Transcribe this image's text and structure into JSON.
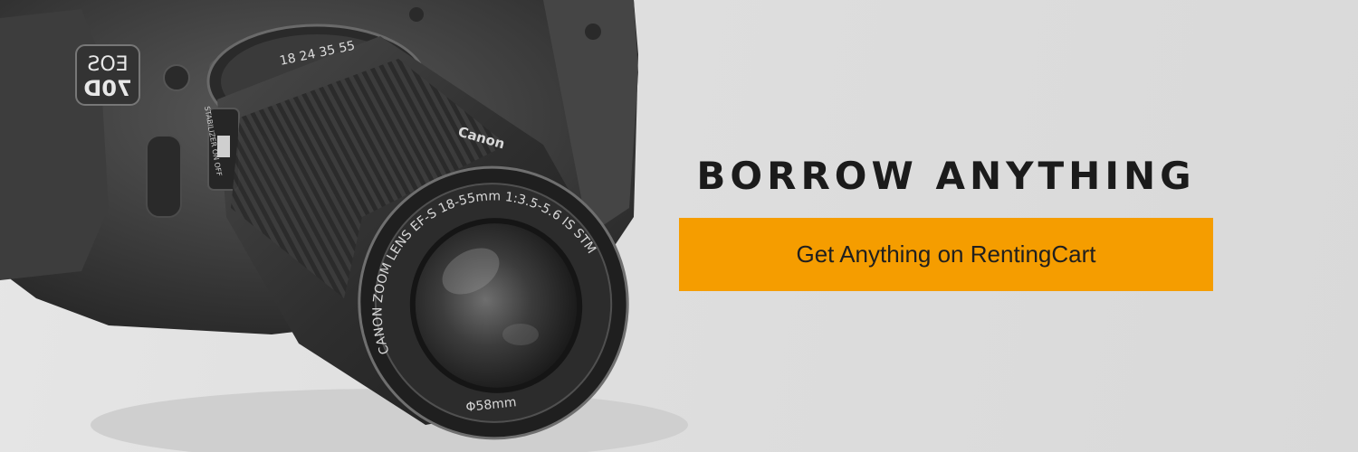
{
  "banner": {
    "headline": "BORROW ANYTHING",
    "cta_label": "Get Anything on RentingCart",
    "accent_color": "#f59d00"
  },
  "camera": {
    "icon": "camera-photo",
    "model_badge_top": "EOS",
    "model_badge_bottom": "70D",
    "lens_ring_text": "CANON ZOOM LENS EF-S 18-55mm 1:3.5-5.6 IS STM",
    "filter_text": "Φ58mm",
    "brand_text": "Canon",
    "focal_marks": "18 24 35 55",
    "switch_text": "STABILIZER ON OFF"
  }
}
